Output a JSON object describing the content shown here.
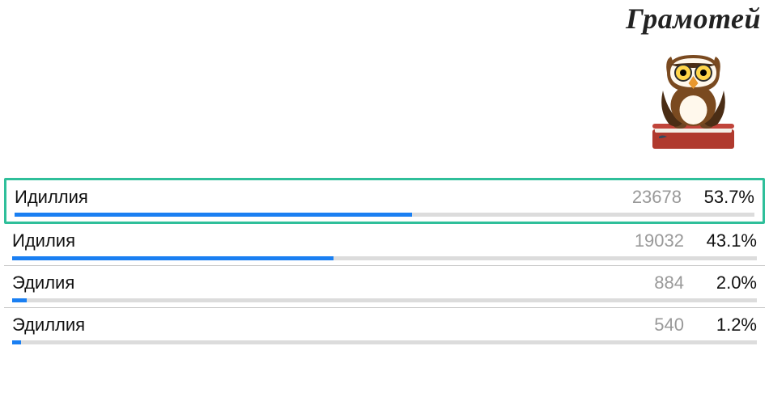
{
  "logo": {
    "text": "Грамотей"
  },
  "results": {
    "options": [
      {
        "label": "Идиллия",
        "count": "23678",
        "percent": 53.7,
        "percent_label": "53.7%",
        "selected": true
      },
      {
        "label": "Идилия",
        "count": "19032",
        "percent": 43.1,
        "percent_label": "43.1%",
        "selected": false
      },
      {
        "label": "Эдилия",
        "count": "884",
        "percent": 2.0,
        "percent_label": "2.0%",
        "selected": false
      },
      {
        "label": "Эдиллия",
        "count": "540",
        "percent": 1.2,
        "percent_label": "1.2%",
        "selected": false
      }
    ]
  },
  "chart_data": {
    "type": "bar",
    "title": "",
    "xlabel": "",
    "ylabel": "",
    "ylim": [
      0,
      100
    ],
    "categories": [
      "Идиллия",
      "Идилия",
      "Эдилия",
      "Эдиллия"
    ],
    "series": [
      {
        "name": "percent",
        "values": [
          53.7,
          43.1,
          2.0,
          1.2
        ]
      },
      {
        "name": "count",
        "values": [
          23678,
          19032,
          884,
          540
        ]
      }
    ],
    "highlight_index": 0
  }
}
